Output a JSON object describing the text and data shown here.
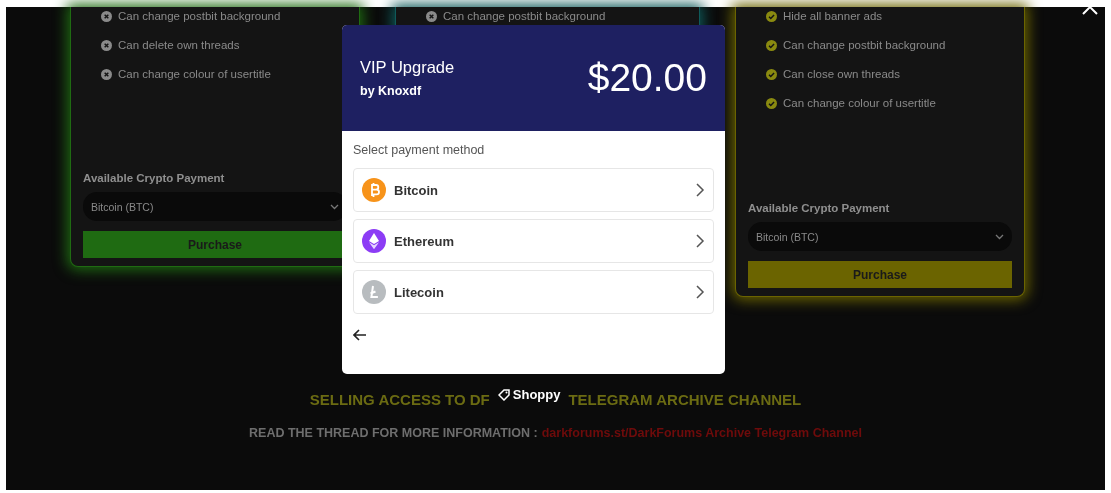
{
  "plans": [
    {
      "color": "#1f6b12",
      "features": [
        {
          "text": "Can change postbit background",
          "included": false
        },
        {
          "text": "Can delete own threads",
          "included": false
        },
        {
          "text": "Can change colour of usertitle",
          "included": false
        }
      ],
      "payment_label": "Available Crypto Payment",
      "payment_select": "Bitcoin (BTC)",
      "purchase": "Purchase"
    },
    {
      "color": "#0f5a5a",
      "features": [
        {
          "text": "Can change postbit background",
          "included": false
        }
      ]
    },
    {
      "color": "#6b6400",
      "features": [
        {
          "text": "Hide all banner ads",
          "included": true
        },
        {
          "text": "Can change postbit background",
          "included": true
        },
        {
          "text": "Can close own threads",
          "included": true
        },
        {
          "text": "Can change colour of usertitle",
          "included": true
        }
      ],
      "payment_label": "Available Crypto Payment",
      "payment_select": "Bitcoin (BTC)",
      "purchase": "Purchase"
    }
  ],
  "notice": {
    "headline_start": "SELLING ACCESS TO DF",
    "headline_end": "TELEGRAM ARCHIVE CHANNEL",
    "info": "READ THE THREAD FOR MORE INFORMATION :",
    "link": "darkforums.st/DarkForums Archive Telegram Channel"
  },
  "modal": {
    "title": "VIP Upgrade",
    "seller": "by Knoxdf",
    "price": "$20.00",
    "prompt": "Select payment method",
    "methods": [
      {
        "name": "Bitcoin",
        "kind": "bitcoin"
      },
      {
        "name": "Ethereum",
        "kind": "ethereum"
      },
      {
        "name": "Litecoin",
        "kind": "litecoin"
      }
    ],
    "brand": "Shoppy"
  }
}
